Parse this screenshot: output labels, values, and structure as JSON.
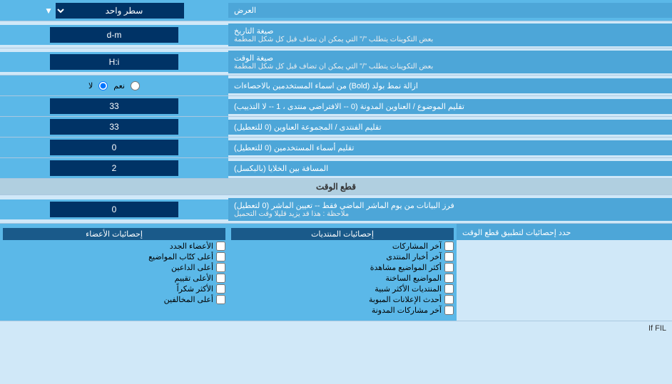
{
  "header": {
    "label": "العرض",
    "dropdown_label": "سطر واحد"
  },
  "rows": [
    {
      "id": "date_format",
      "label": "صيغة التاريخ",
      "sublabel": "بعض التكوينات يتطلب \"/\" التي يمكن ان تضاف قبل كل شكل المطمة",
      "control_value": "d-m",
      "control_type": "input"
    },
    {
      "id": "time_format",
      "label": "صيغة الوقت",
      "sublabel": "بعض التكوينات يتطلب \"/\" التي يمكن ان تضاف قبل كل شكل المطمة",
      "control_value": "H:i",
      "control_type": "input"
    },
    {
      "id": "bold_remove",
      "label": "ازالة نمط بولد (Bold) من اسماء المستخدمين بالاحصاءات",
      "control_type": "radio",
      "radio_yes": "نعم",
      "radio_no": "لا",
      "radio_selected": "no"
    },
    {
      "id": "topics_order",
      "label": "تقليم الموضوع / العناوين المدونة (0 -- الافتراضي منتدى ، 1 -- لا التذييب)",
      "control_value": "33",
      "control_type": "input"
    },
    {
      "id": "forum_order",
      "label": "تقليم الفنتدى / المجموعة العناوين (0 للتعطيل)",
      "control_value": "33",
      "control_type": "input"
    },
    {
      "id": "usernames_trim",
      "label": "تقليم أسماء المستخدمين (0 للتعطيل)",
      "control_value": "0",
      "control_type": "input"
    },
    {
      "id": "cell_spacing",
      "label": "المسافة بين الخلايا (بالبكسل)",
      "control_value": "2",
      "control_type": "input"
    }
  ],
  "realtime_section": {
    "header": "قطع الوقت",
    "row_label": "فرز البيانات من يوم الماشر الماضي فقط -- تعيين الماشر (0 لتعطيل)",
    "row_sublabel": "ملاحظة : هذا قد يزيد قليلا وقت التحميل",
    "row_value": "0",
    "stats_header_label": "حدد إحصائيات لتطبيق قطع الوقت",
    "col1_header": "إحصائيات الأعضاء",
    "col2_header": "إحصائيات المنتديات",
    "col1_items": [
      "الأعضاء الجدد",
      "أعلى كتّاب المواضيع",
      "أعلى الداعين",
      "الأعلى تقييم",
      "الأكثر شكراً",
      "أعلى المخالفين"
    ],
    "col2_items": [
      "آخر المشاركات",
      "آخر أخبار المنتدى",
      "أكثر المواضيع مشاهدة",
      "المواضيع الساخنة",
      "المنتديات الأكثر شبية",
      "أحدث الإعلانات المبوبة",
      "آخر مشاركات المدونة"
    ]
  },
  "footer_text": "If FIL"
}
